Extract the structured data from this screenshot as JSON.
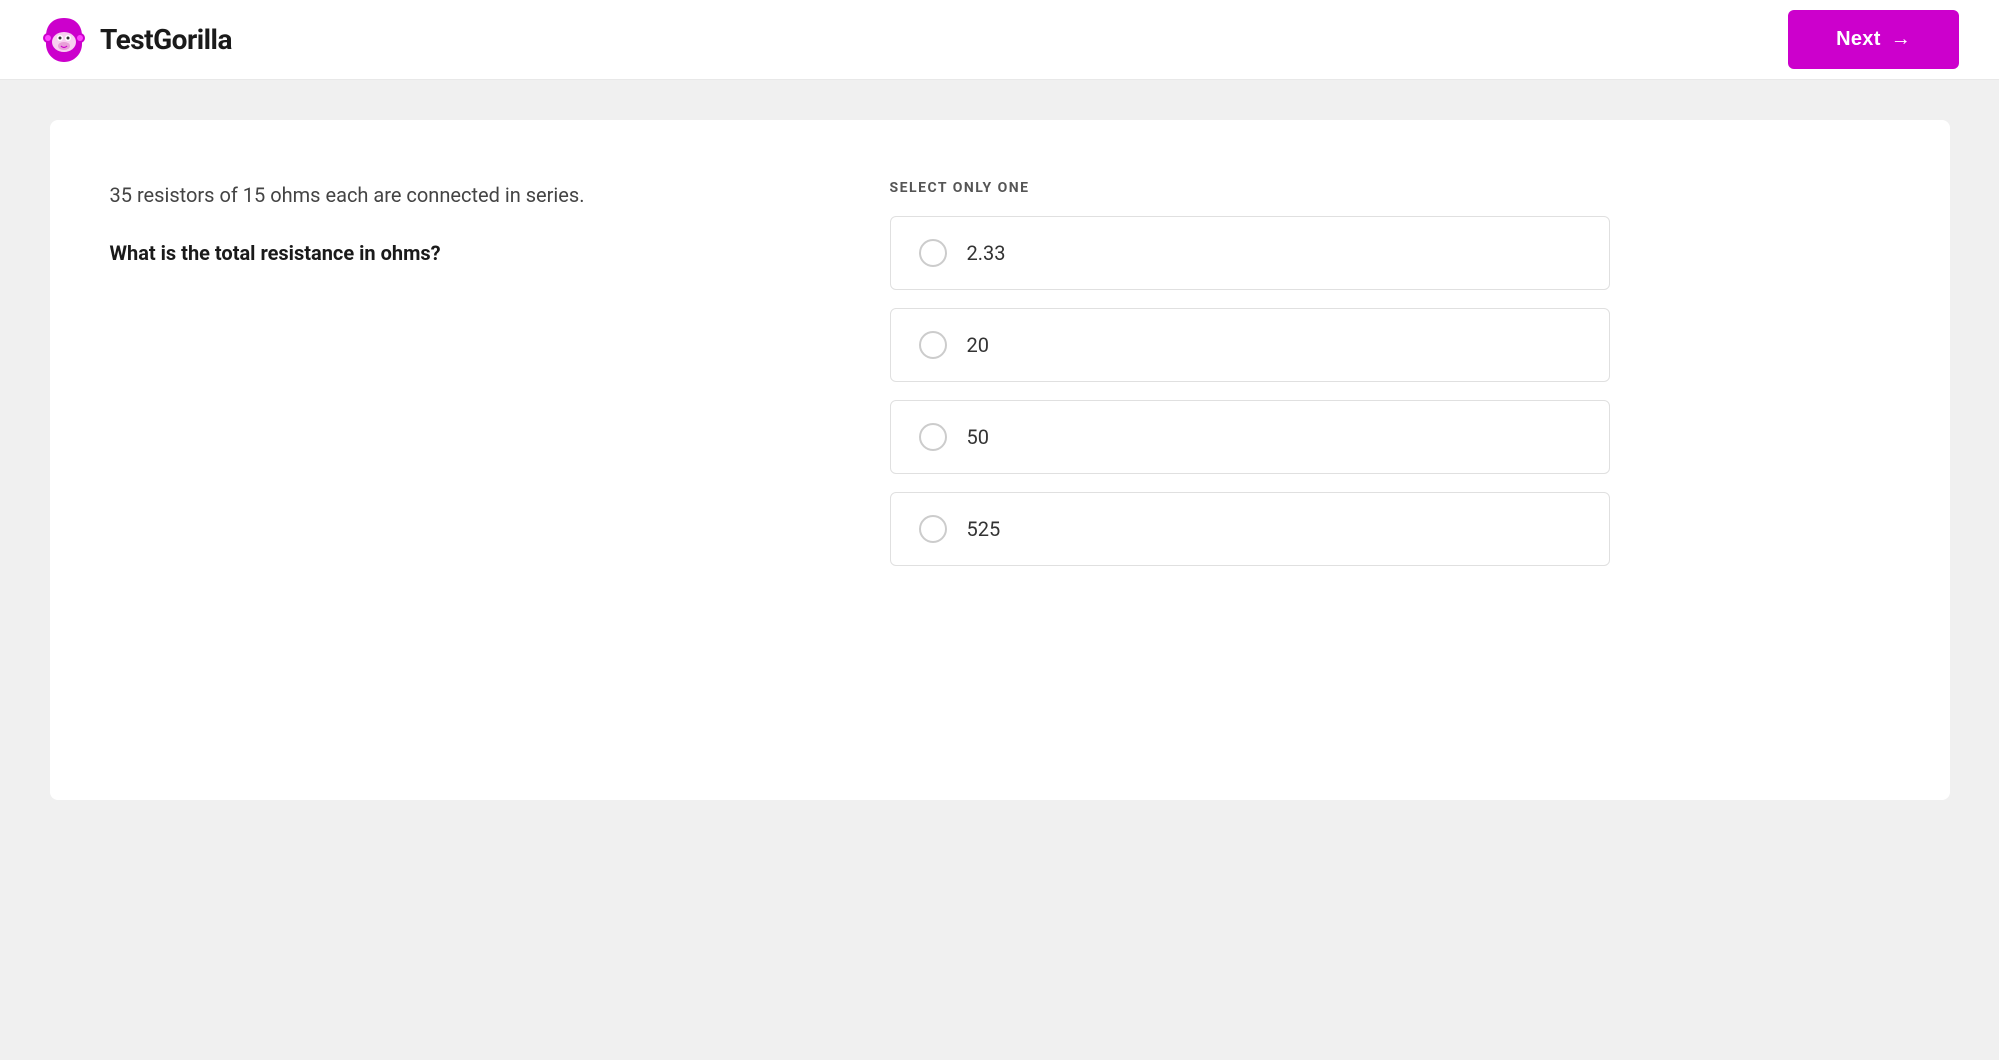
{
  "header": {
    "logo_text": "TestGorilla",
    "next_button_label": "Next",
    "next_arrow": "→"
  },
  "question": {
    "context": "35 resistors of 15 ohms each are connected in series.",
    "text": "What is the total resistance in ohms?",
    "select_label": "SELECT ONLY ONE"
  },
  "answers": [
    {
      "id": "option-1",
      "value": "2.33"
    },
    {
      "id": "option-2",
      "value": "20"
    },
    {
      "id": "option-3",
      "value": "50"
    },
    {
      "id": "option-4",
      "value": "525"
    }
  ],
  "colors": {
    "brand_primary": "#cc00cc",
    "brand_dark": "#1a1a1a"
  }
}
